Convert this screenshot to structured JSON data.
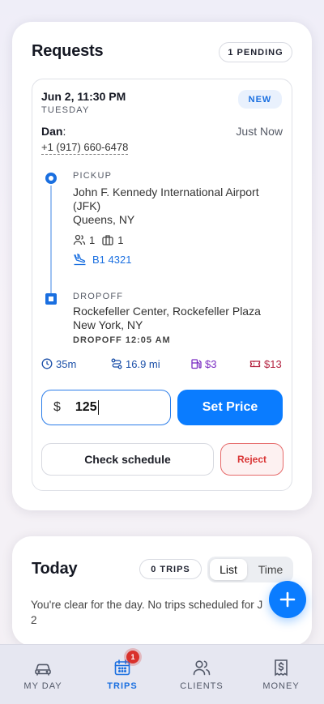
{
  "requests": {
    "title": "Requests",
    "pending_label": "1 PENDING",
    "request": {
      "datetime": "Jun 2, 11:30 PM",
      "weekday": "TUESDAY",
      "status_badge": "NEW",
      "client_name": "Dan",
      "client_colon": ":",
      "phone": "+1 (917) 660-6478",
      "received": "Just Now",
      "pickup": {
        "label": "PICKUP",
        "place_line1": "John F. Kennedy International Airport",
        "place_line2": "(JFK)",
        "city": "Queens, NY",
        "passengers": "1",
        "luggage": "1",
        "flight": "B1 4321"
      },
      "dropoff": {
        "label": "DROPOFF",
        "place": "Rockefeller Center, Rockefeller Plaza",
        "city": "New York, NY",
        "time": "DROPOFF 12:05 AM"
      },
      "stats": {
        "duration": "35m",
        "distance": "16.9 mi",
        "fuel": "$3",
        "toll": "$13"
      },
      "price": {
        "currency": "$",
        "value": "125"
      },
      "set_price_label": "Set Price",
      "check_schedule_label": "Check schedule",
      "reject_label": "Reject"
    }
  },
  "today": {
    "title": "Today",
    "trips_label": "0 TRIPS",
    "view_options": [
      "List",
      "Time"
    ],
    "selected_view": "List",
    "empty_line1": "You're clear for the day. No trips scheduled for J",
    "empty_line2": "2"
  },
  "tabbar": {
    "tabs": [
      {
        "label": "MY DAY",
        "icon": "car-icon"
      },
      {
        "label": "TRIPS",
        "icon": "calendar-icon",
        "badge": "1"
      },
      {
        "label": "CLIENTS",
        "icon": "users-icon"
      },
      {
        "label": "MONEY",
        "icon": "receipt-dollar-icon"
      }
    ],
    "active": "TRIPS"
  },
  "colors": {
    "accent": "#0a7cff",
    "reject": "#d93434",
    "fuel": "#7a2bc2",
    "toll": "#b3213f"
  }
}
